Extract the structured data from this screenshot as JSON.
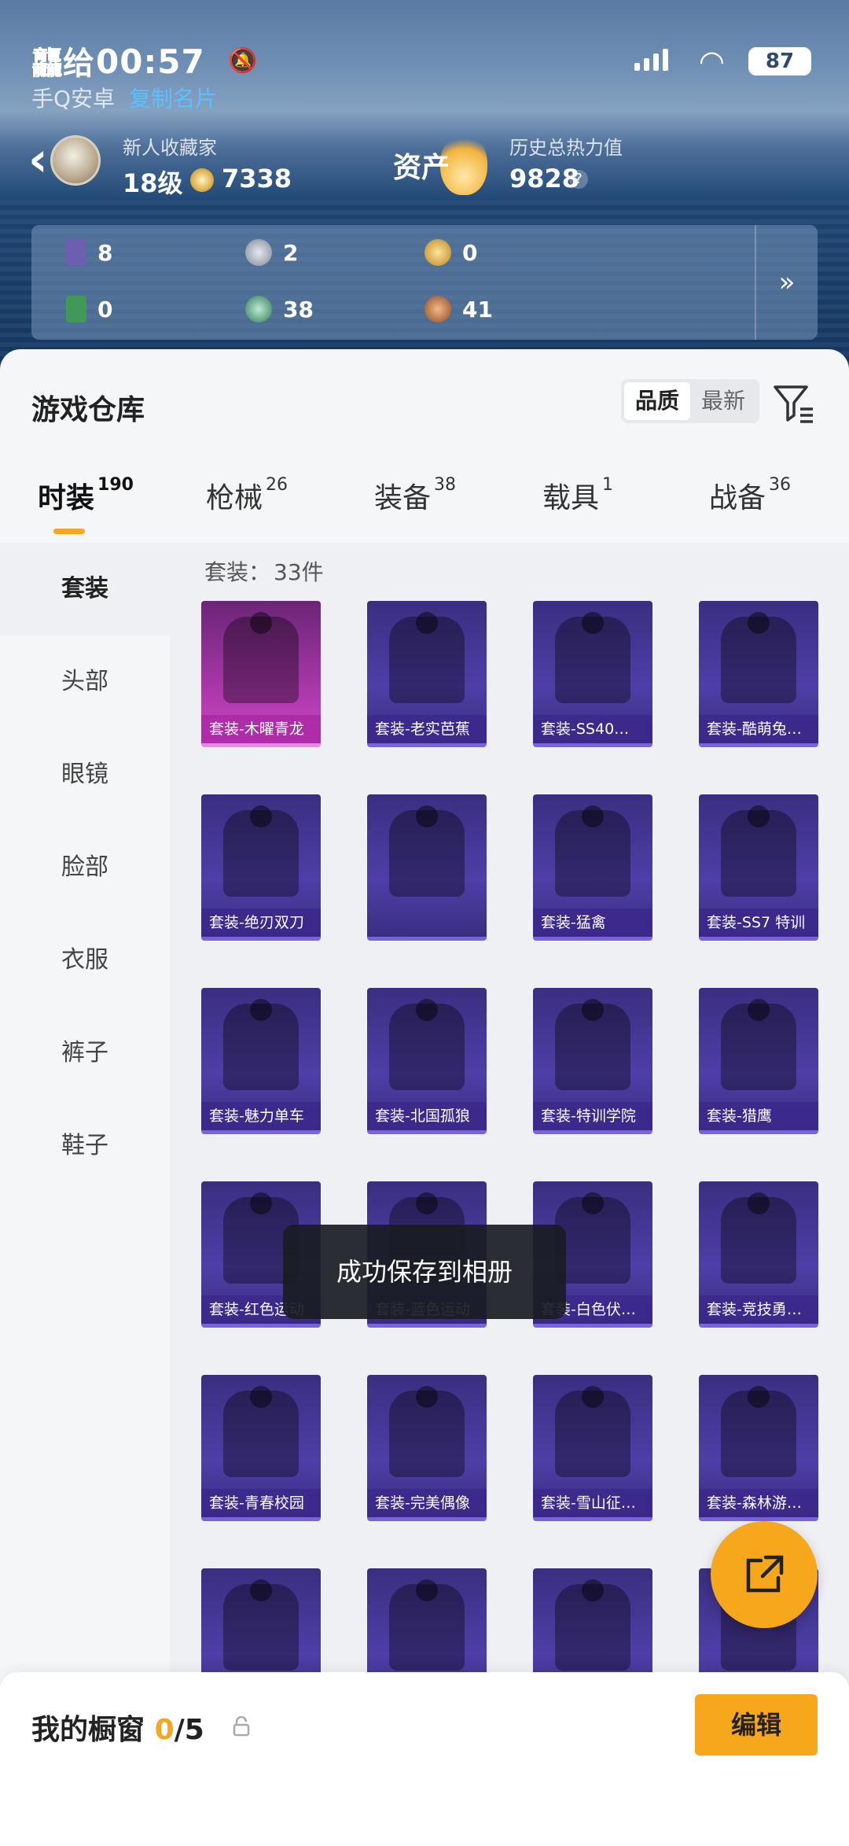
{
  "status_bar": {
    "nickname": "龘给",
    "time": "00:57",
    "battery": "87"
  },
  "sub_caption": {
    "source": "手Q安卓",
    "link": "复制名片"
  },
  "header": {
    "rank_title": "新人收藏家",
    "rank_level": "18级",
    "coin_value": "7338",
    "asset_label": "资产",
    "heat_title": "历史总热力值",
    "heat_value": "9828",
    "help": "?"
  },
  "resources": [
    {
      "icon": "purple-card-icon",
      "value": "8",
      "color": "#6c5fb0"
    },
    {
      "icon": "silver-token-icon",
      "value": "2",
      "color": "#9aa4b3"
    },
    {
      "icon": "gold-token-icon",
      "value": "0",
      "color": "#d8a63a"
    },
    {
      "icon": "green-card-icon",
      "value": "0",
      "color": "#3f9a5a"
    },
    {
      "icon": "jade-orb-icon",
      "value": "38",
      "color": "#4e9b78"
    },
    {
      "icon": "bronze-orb-icon",
      "value": "41",
      "color": "#c06a36"
    }
  ],
  "resources_more": "»",
  "sheet": {
    "title": "游戏仓库",
    "sort_options": [
      "品质",
      "最新"
    ],
    "active_sort": 0
  },
  "categories": [
    {
      "label": "时装",
      "count": "190"
    },
    {
      "label": "枪械",
      "count": "26"
    },
    {
      "label": "装备",
      "count": "38"
    },
    {
      "label": "载具",
      "count": "1"
    },
    {
      "label": "战备",
      "count": "36"
    }
  ],
  "side_nav": [
    "套装",
    "头部",
    "眼镜",
    "脸部",
    "衣服",
    "裤子",
    "鞋子"
  ],
  "grid_caption": {
    "label": "套装：",
    "count": "33件"
  },
  "items": [
    {
      "label": "套装-木曜青龙",
      "quality": "pink"
    },
    {
      "label": "套装-老实芭蕉",
      "quality": "purple"
    },
    {
      "label": "套装-SS40…",
      "quality": "purple"
    },
    {
      "label": "套装-酷萌兔…",
      "quality": "purple"
    },
    {
      "label": "套装-绝刃双刀",
      "quality": "purple"
    },
    {
      "label": "",
      "quality": "purple"
    },
    {
      "label": "套装-猛禽",
      "quality": "purple"
    },
    {
      "label": "套装-SS7 特训",
      "quality": "purple"
    },
    {
      "label": "套装-魅力单车",
      "quality": "purple"
    },
    {
      "label": "套装-北国孤狼",
      "quality": "purple"
    },
    {
      "label": "套装-特训学院",
      "quality": "purple"
    },
    {
      "label": "套装-猎鹰",
      "quality": "purple"
    },
    {
      "label": "套装-红色运动",
      "quality": "purple"
    },
    {
      "label": "套装-蓝色运动",
      "quality": "purple"
    },
    {
      "label": "套装-白色伏…",
      "quality": "purple"
    },
    {
      "label": "套装-竞技勇…",
      "quality": "purple"
    },
    {
      "label": "套装-青春校园",
      "quality": "purple"
    },
    {
      "label": "套装-完美偶像",
      "quality": "purple"
    },
    {
      "label": "套装-雪山征…",
      "quality": "purple"
    },
    {
      "label": "套装-森林游…",
      "quality": "purple"
    },
    {
      "label": "",
      "quality": "purple"
    },
    {
      "label": "",
      "quality": "purple"
    },
    {
      "label": "",
      "quality": "purple"
    },
    {
      "label": "",
      "quality": "purple"
    }
  ],
  "toast": "成功保存到相册",
  "showcase": {
    "title": "我的橱窗",
    "count": "0",
    "total": "/5",
    "edit_label": "编辑"
  },
  "colors": {
    "accent": "#f7a71c",
    "purple_card": "#4e3ea7",
    "pink_card": "#b23ab0"
  }
}
